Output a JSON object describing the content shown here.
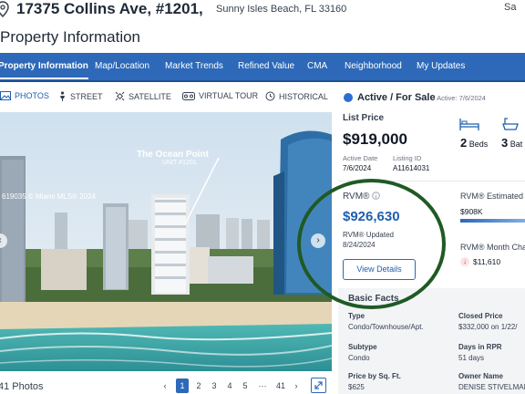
{
  "header": {
    "address": "17375 Collins Ave, #1201,",
    "city_line": "Sunny Isles Beach, FL 33160",
    "save_label": "Sa",
    "page_title": "Property Information"
  },
  "nav": {
    "items": [
      {
        "label": "Property Information",
        "active": true
      },
      {
        "label": "Map/Location"
      },
      {
        "label": "Market Trends"
      },
      {
        "label": "Refined Value"
      },
      {
        "label": "CMA"
      },
      {
        "label": "Neighborhood"
      },
      {
        "label": "My Updates"
      }
    ]
  },
  "media_tabs": [
    {
      "label": "PHOTOS",
      "icon": "photo-icon",
      "active": true
    },
    {
      "label": "STREET",
      "icon": "person-icon"
    },
    {
      "label": "SATELLITE",
      "icon": "satellite-icon"
    },
    {
      "label": "VIRTUAL TOUR",
      "icon": "vr-icon"
    },
    {
      "label": "HISTORICAL",
      "icon": "history-icon"
    }
  ],
  "photo": {
    "credit": "619035 © Miami MLS® 2024",
    "overlay_name": "The Ocean Point",
    "overlay_unit": "UNIT #1201"
  },
  "pagination": {
    "count_text": "41 Photos",
    "pages": [
      "1",
      "2",
      "3",
      "4",
      "5",
      "···",
      "41"
    ],
    "current": "1"
  },
  "summary": {
    "status": "Active / For Sale",
    "status_date": "· Active: 7/6/2024",
    "list_price_label": "List Price",
    "list_price": "$919,000",
    "active_date_label": "Active Date",
    "active_date": "7/6/2024",
    "listing_id_label": "Listing ID",
    "listing_id": "A11614031",
    "beds_num": "2",
    "beds_label": "Beds",
    "baths_num": "3",
    "baths_label": "Bat"
  },
  "rvm": {
    "label": "RVM®",
    "value": "$926,630",
    "updated_label": "RVM® Updated",
    "updated_date": "8/24/2024",
    "button": "View Details",
    "estimated_label": "RVM® Estimated R",
    "estimated_value": "$908K",
    "month_change_label": "RVM® Month Cha",
    "month_change_value": "$11,610"
  },
  "basic_facts": {
    "title": "Basic Facts",
    "items": [
      {
        "label": "Type",
        "value": "Condo/Townhouse/Apt."
      },
      {
        "label": "Closed Price",
        "value": "$332,000 on 1/22/"
      },
      {
        "label": "Subtype",
        "value": "Condo"
      },
      {
        "label": "Days in RPR",
        "value": "51 days"
      },
      {
        "label": "Price by Sq. Ft.",
        "value": "$625"
      },
      {
        "label": "Owner Name",
        "value": "DENISE STIVELMAN"
      }
    ]
  },
  "colors": {
    "nav_bg": "#2d69b8",
    "accent": "#1f5fae",
    "annotation_circle": "#1f5a24"
  }
}
